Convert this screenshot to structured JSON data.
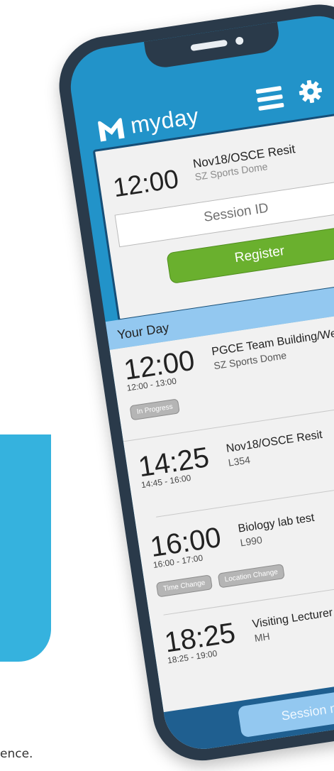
{
  "background": {
    "caption_fragment": "ence.",
    "accent_color": "#35b2de"
  },
  "app": {
    "name": "myday",
    "brand_color": "#2293c9",
    "icons": [
      "menu-icon",
      "gear-icon"
    ]
  },
  "session_card": {
    "time": "12:00",
    "title": "Nov18/OSCE Resit",
    "location": "SZ Sports Dome",
    "input_placeholder": "Session ID",
    "register_label": "Register",
    "right_text": "Re"
  },
  "your_day": {
    "title": "Your Day",
    "items": [
      {
        "time": "12:00",
        "range": "12:00 - 13:00",
        "title": "PGCE Team Building/We",
        "location": "SZ Sports Dome",
        "badges": [
          "In Progress"
        ]
      },
      {
        "time": "14:25",
        "range": "14:45 - 16:00",
        "title": "Nov18/OSCE Resit",
        "location": "L354",
        "badges": []
      },
      {
        "time": "16:00",
        "range": "16:00 - 17:00",
        "title": "Biology lab test",
        "location": "L990",
        "badges": [
          "Time Change",
          "Location Change"
        ]
      },
      {
        "time": "18:25",
        "range": "18:25 - 19:00",
        "title": "Visiting Lecturer",
        "location": "MH",
        "badges": []
      }
    ]
  },
  "bottom": {
    "button_label": "Session not listed"
  }
}
